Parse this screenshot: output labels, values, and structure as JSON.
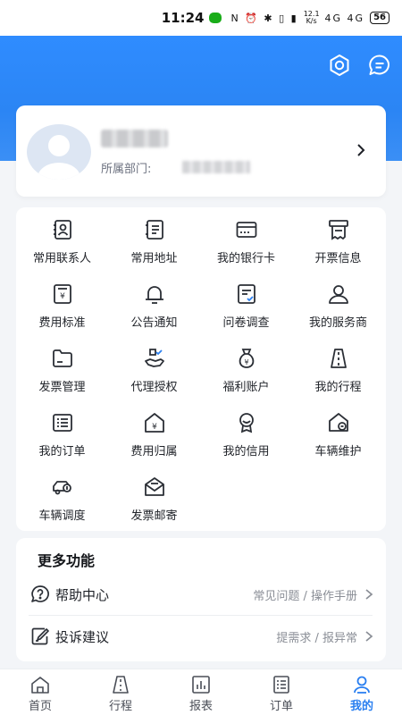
{
  "status_bar": {
    "time": "11:24",
    "icons": "N ⏰ ✱ ▯ ▮",
    "net_speed_top": "12.1",
    "net_speed_bottom": "K/s",
    "signal": "4G 4G",
    "battery": "56"
  },
  "header": {
    "settings_icon": "gear-icon",
    "message_icon": "message-icon"
  },
  "profile": {
    "dept_label": "所属部门:"
  },
  "grid": {
    "items": [
      {
        "label": "常用联系人",
        "icon": "contacts-icon"
      },
      {
        "label": "常用地址",
        "icon": "address-icon"
      },
      {
        "label": "我的银行卡",
        "icon": "bank-card-icon"
      },
      {
        "label": "开票信息",
        "icon": "invoice-info-icon"
      },
      {
        "label": "费用标准",
        "icon": "expense-standard-icon"
      },
      {
        "label": "公告通知",
        "icon": "bell-icon"
      },
      {
        "label": "问卷调查",
        "icon": "survey-icon"
      },
      {
        "label": "我的服务商",
        "icon": "service-provider-icon"
      },
      {
        "label": "发票管理",
        "icon": "folder-icon"
      },
      {
        "label": "代理授权",
        "icon": "authorization-icon"
      },
      {
        "label": "福利账户",
        "icon": "money-bag-icon"
      },
      {
        "label": "我的行程",
        "icon": "road-icon"
      },
      {
        "label": "我的订单",
        "icon": "order-list-icon"
      },
      {
        "label": "费用归属",
        "icon": "expense-home-icon"
      },
      {
        "label": "我的信用",
        "icon": "credit-badge-icon"
      },
      {
        "label": "车辆维护",
        "icon": "vehicle-maintenance-icon"
      },
      {
        "label": "车辆调度",
        "icon": "vehicle-dispatch-icon"
      },
      {
        "label": "发票邮寄",
        "icon": "mail-icon"
      }
    ]
  },
  "more": {
    "title": "更多功能",
    "rows": [
      {
        "label": "帮助中心",
        "sub": "常见问题 / 操作手册",
        "icon": "help-icon"
      },
      {
        "label": "投诉建议",
        "sub": "提需求 / 报异常",
        "icon": "feedback-icon"
      }
    ]
  },
  "nav": {
    "items": [
      {
        "label": "首页",
        "icon": "home-icon"
      },
      {
        "label": "行程",
        "icon": "road-icon"
      },
      {
        "label": "报表",
        "icon": "chart-icon"
      },
      {
        "label": "订单",
        "icon": "list-icon"
      },
      {
        "label": "我的",
        "icon": "person-icon"
      }
    ],
    "active_index": 4,
    "active_color": "#2a7ff0"
  }
}
